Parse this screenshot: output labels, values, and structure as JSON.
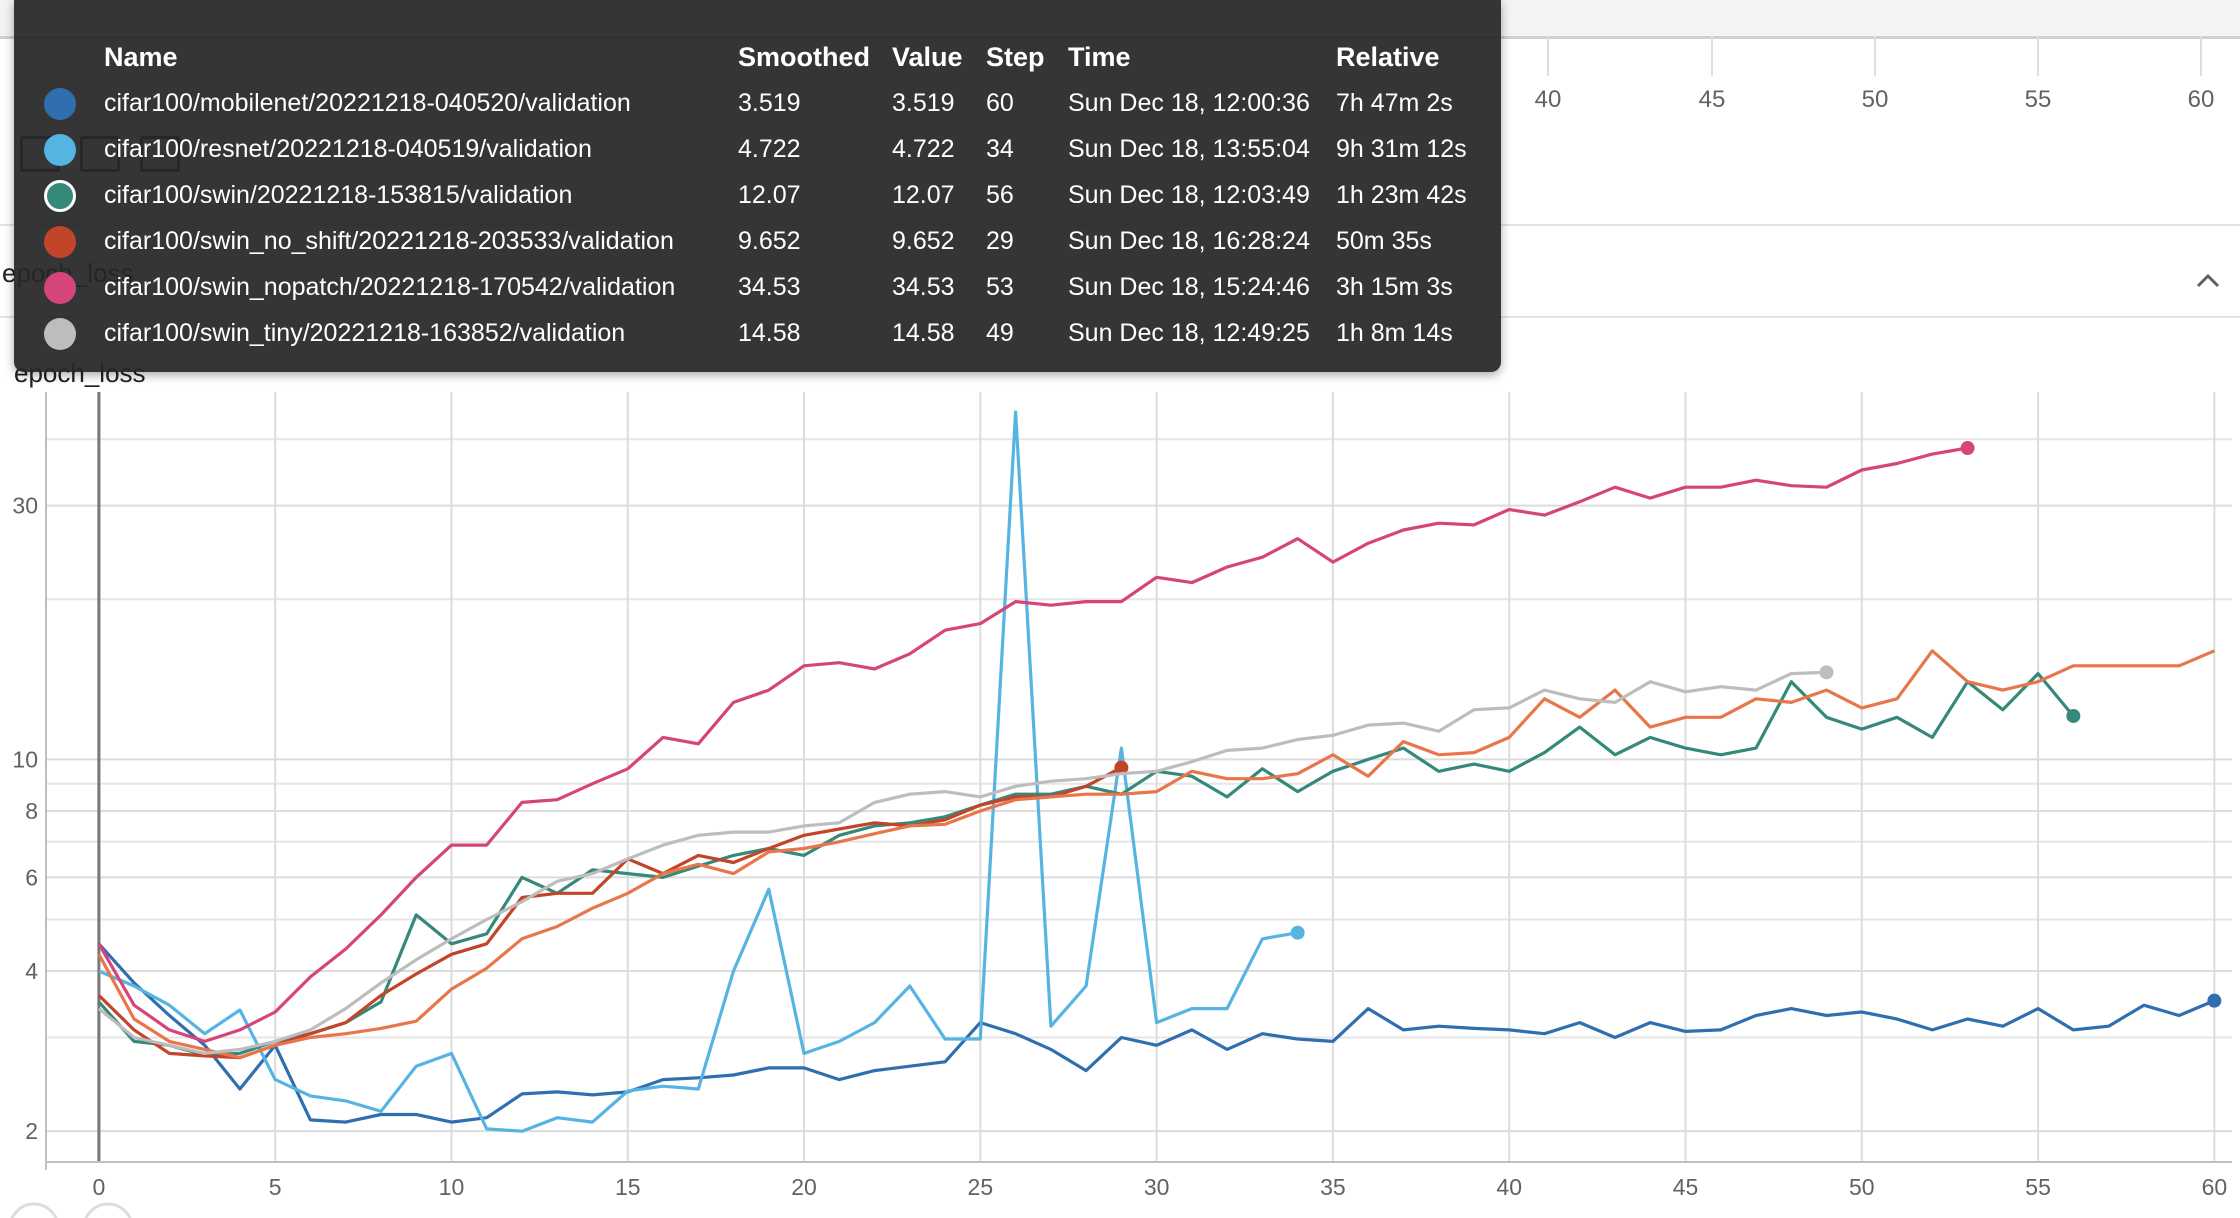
{
  "background": {
    "x_tick_labels": [
      "40",
      "45",
      "50",
      "55",
      "60"
    ],
    "card_title": "epoch_loss"
  },
  "tooltip": {
    "headers": {
      "name": "Name",
      "smoothed": "Smoothed",
      "value": "Value",
      "step": "Step",
      "time": "Time",
      "relative": "Relative"
    },
    "rows": [
      {
        "color": "#2f6fb0",
        "name": "cifar100/mobilenet/20221218-040520/validation",
        "smoothed": "3.519",
        "value": "3.519",
        "step": "60",
        "time": "Sun Dec 18, 12:00:36",
        "relative": "7h 47m 2s"
      },
      {
        "color": "#56b4e3",
        "name": "cifar100/resnet/20221218-040519/validation",
        "smoothed": "4.722",
        "value": "4.722",
        "step": "34",
        "time": "Sun Dec 18, 13:55:04",
        "relative": "9h 31m 12s"
      },
      {
        "color": "#34897a",
        "name": "cifar100/swin/20221218-153815/validation",
        "smoothed": "12.07",
        "value": "12.07",
        "step": "56",
        "time": "Sun Dec 18, 12:03:49",
        "relative": "1h 23m 42s"
      },
      {
        "color": "#c2452a",
        "name": "cifar100/swin_no_shift/20221218-203533/validation",
        "smoothed": "9.652",
        "value": "9.652",
        "step": "29",
        "time": "Sun Dec 18, 16:28:24",
        "relative": "50m 35s"
      },
      {
        "color": "#d6457a",
        "name": "cifar100/swin_nopatch/20221218-170542/validation",
        "smoothed": "34.53",
        "value": "34.53",
        "step": "53",
        "time": "Sun Dec 18, 15:24:46",
        "relative": "3h 15m 3s"
      },
      {
        "color": "#bdbdbd",
        "name": "cifar100/swin_tiny/20221218-163852/validation",
        "smoothed": "14.58",
        "value": "14.58",
        "step": "49",
        "time": "Sun Dec 18, 12:49:25",
        "relative": "1h 8m 14s"
      }
    ]
  },
  "chart_data": {
    "type": "line",
    "title": "epoch_loss",
    "xlabel": "",
    "ylabel": "",
    "xlim": [
      -1.5,
      60.5
    ],
    "ylim": [
      1.75,
      45
    ],
    "y_scale": "log",
    "x_ticks": [
      0,
      5,
      10,
      15,
      20,
      25,
      30,
      35,
      40,
      45,
      50,
      55,
      60
    ],
    "y_tick_labels": [
      2,
      4,
      6,
      8,
      10,
      30
    ],
    "y_minor_gridlines": [
      3,
      5,
      7,
      9,
      20,
      40
    ],
    "grid": true,
    "legend": "none",
    "series": [
      {
        "color": "#2f6fb0",
        "end_marker": true,
        "x": [
          0,
          1,
          2,
          3,
          4,
          5,
          6,
          7,
          8,
          9,
          10,
          11,
          12,
          13,
          14,
          15,
          16,
          17,
          18,
          19,
          20,
          21,
          22,
          23,
          24,
          25,
          26,
          27,
          28,
          29,
          30,
          31,
          32,
          33,
          34,
          35,
          36,
          37,
          38,
          39,
          40,
          41,
          42,
          43,
          44,
          45,
          46,
          47,
          48,
          49,
          50,
          51,
          52,
          53,
          54,
          55,
          56,
          57,
          58,
          59,
          60
        ],
        "y": [
          4.5,
          3.8,
          3.3,
          2.9,
          2.4,
          2.9,
          2.1,
          2.08,
          2.15,
          2.15,
          2.08,
          2.12,
          2.35,
          2.37,
          2.34,
          2.37,
          2.5,
          2.52,
          2.55,
          2.63,
          2.63,
          2.5,
          2.6,
          2.65,
          2.7,
          3.2,
          3.05,
          2.85,
          2.6,
          3.0,
          2.9,
          3.1,
          2.85,
          3.05,
          2.98,
          2.95,
          3.4,
          3.1,
          3.15,
          3.12,
          3.1,
          3.05,
          3.2,
          3.0,
          3.2,
          3.08,
          3.1,
          3.3,
          3.4,
          3.3,
          3.35,
          3.25,
          3.1,
          3.25,
          3.15,
          3.4,
          3.1,
          3.15,
          3.45,
          3.3,
          3.519
        ]
      },
      {
        "color": "#56b4e3",
        "end_marker": true,
        "x": [
          0,
          1,
          2,
          3,
          4,
          5,
          6,
          7,
          8,
          9,
          10,
          11,
          12,
          13,
          14,
          15,
          16,
          17,
          18,
          19,
          20,
          21,
          22,
          23,
          24,
          25,
          26,
          27,
          28,
          29,
          30,
          31,
          32,
          33,
          34
        ],
        "y": [
          4.0,
          3.75,
          3.45,
          3.05,
          3.38,
          2.5,
          2.33,
          2.28,
          2.18,
          2.65,
          2.8,
          2.02,
          2.0,
          2.12,
          2.08,
          2.38,
          2.43,
          2.4,
          4.0,
          5.7,
          2.8,
          2.95,
          3.2,
          3.75,
          2.98,
          2.98,
          45,
          3.15,
          3.75,
          10.5,
          3.2,
          3.4,
          3.4,
          4.6,
          4.722
        ]
      },
      {
        "color": "#34897a",
        "end_marker": true,
        "x": [
          0,
          1,
          2,
          3,
          4,
          5,
          6,
          7,
          8,
          9,
          10,
          11,
          12,
          13,
          14,
          15,
          16,
          17,
          18,
          19,
          20,
          21,
          22,
          23,
          24,
          25,
          26,
          27,
          28,
          29,
          30,
          31,
          32,
          33,
          34,
          35,
          36,
          37,
          38,
          39,
          40,
          41,
          42,
          43,
          44,
          45,
          46,
          47,
          48,
          49,
          50,
          51,
          52,
          53,
          54,
          55,
          56
        ],
        "y": [
          3.5,
          2.95,
          2.9,
          2.78,
          2.8,
          2.95,
          3.05,
          3.2,
          3.5,
          5.1,
          4.5,
          4.7,
          6.0,
          5.6,
          6.2,
          6.1,
          6.0,
          6.3,
          6.6,
          6.8,
          6.6,
          7.2,
          7.5,
          7.6,
          7.8,
          8.2,
          8.6,
          8.6,
          8.9,
          8.6,
          9.5,
          9.3,
          8.5,
          9.6,
          8.7,
          9.5,
          10.0,
          10.5,
          9.5,
          9.8,
          9.5,
          10.3,
          11.5,
          10.2,
          11.0,
          10.5,
          10.2,
          10.5,
          14.0,
          12.0,
          11.4,
          12.0,
          11.0,
          14.0,
          12.4,
          14.5,
          12.07
        ]
      },
      {
        "color": "#c2452a",
        "end_marker": true,
        "x": [
          0,
          1,
          2,
          3,
          4,
          5,
          6,
          7,
          8,
          9,
          10,
          11,
          12,
          13,
          14,
          15,
          16,
          17,
          18,
          19,
          20,
          21,
          22,
          23,
          24,
          25,
          26,
          27,
          28,
          29
        ],
        "y": [
          3.6,
          3.1,
          2.8,
          2.77,
          2.75,
          2.9,
          3.05,
          3.2,
          3.6,
          3.95,
          4.3,
          4.5,
          5.5,
          5.6,
          5.6,
          6.5,
          6.1,
          6.6,
          6.4,
          6.8,
          7.2,
          7.4,
          7.6,
          7.5,
          7.7,
          8.2,
          8.5,
          8.5,
          8.9,
          9.652
        ]
      },
      {
        "color": "#e8764a",
        "end_marker": false,
        "x": [
          0,
          1,
          2,
          3,
          4,
          5,
          6,
          7,
          8,
          9,
          10,
          11,
          12,
          13,
          14,
          15,
          16,
          17,
          18,
          19,
          20,
          21,
          22,
          23,
          24,
          25,
          26,
          27,
          28,
          29,
          30,
          31,
          32,
          33,
          34,
          35,
          36,
          37,
          38,
          39,
          40,
          41,
          42,
          43,
          44,
          45,
          46,
          47,
          48,
          49,
          50,
          51,
          52,
          53,
          54,
          55,
          56,
          57,
          58,
          59,
          60
        ],
        "y": [
          4.3,
          3.25,
          2.95,
          2.85,
          2.75,
          2.9,
          3.0,
          3.05,
          3.12,
          3.22,
          3.7,
          4.05,
          4.6,
          4.85,
          5.25,
          5.6,
          6.1,
          6.35,
          6.1,
          6.7,
          6.8,
          7.0,
          7.25,
          7.5,
          7.55,
          8.0,
          8.4,
          8.5,
          8.6,
          8.6,
          8.7,
          9.5,
          9.2,
          9.2,
          9.4,
          10.2,
          9.3,
          10.8,
          10.2,
          10.3,
          11.0,
          13.0,
          12.0,
          13.5,
          11.5,
          12.0,
          12.0,
          13.0,
          12.8,
          13.5,
          12.5,
          13.0,
          16.0,
          14.0,
          13.5,
          14.0,
          15.0,
          15.0,
          15.0,
          15.0,
          16.0
        ]
      },
      {
        "color": "#d6457a",
        "end_marker": true,
        "x": [
          0,
          1,
          2,
          3,
          4,
          5,
          6,
          7,
          8,
          9,
          10,
          11,
          12,
          13,
          14,
          15,
          16,
          17,
          18,
          19,
          20,
          21,
          22,
          23,
          24,
          25,
          26,
          27,
          28,
          29,
          30,
          31,
          32,
          33,
          34,
          35,
          36,
          37,
          38,
          39,
          40,
          41,
          42,
          43,
          44,
          45,
          46,
          47,
          48,
          49,
          50,
          51,
          52,
          53
        ],
        "y": [
          4.5,
          3.45,
          3.1,
          2.95,
          3.1,
          3.35,
          3.9,
          4.4,
          5.1,
          6.0,
          6.9,
          6.9,
          8.3,
          8.4,
          9.0,
          9.6,
          11.0,
          10.7,
          12.8,
          13.5,
          15.0,
          15.2,
          14.8,
          15.8,
          17.5,
          18.0,
          19.8,
          19.5,
          19.8,
          19.8,
          22.0,
          21.5,
          23.0,
          24.0,
          26.0,
          23.5,
          25.5,
          27.0,
          27.8,
          27.6,
          29.5,
          28.8,
          30.5,
          32.5,
          31.0,
          32.5,
          32.5,
          33.5,
          32.7,
          32.5,
          35.0,
          36.0,
          37.5,
          38.5
        ]
      },
      {
        "color": "#bdbdbd",
        "end_marker": true,
        "x": [
          0,
          1,
          2,
          3,
          4,
          5,
          6,
          7,
          8,
          9,
          10,
          11,
          12,
          13,
          14,
          15,
          16,
          17,
          18,
          19,
          20,
          21,
          22,
          23,
          24,
          25,
          26,
          27,
          28,
          29,
          30,
          31,
          32,
          33,
          34,
          35,
          36,
          37,
          38,
          39,
          40,
          41,
          42,
          43,
          44,
          45,
          46,
          47,
          48,
          49
        ],
        "y": [
          3.4,
          3.0,
          2.9,
          2.8,
          2.85,
          2.95,
          3.1,
          3.4,
          3.8,
          4.2,
          4.6,
          5.0,
          5.4,
          5.9,
          6.1,
          6.5,
          6.9,
          7.2,
          7.3,
          7.3,
          7.5,
          7.6,
          8.3,
          8.6,
          8.7,
          8.5,
          8.9,
          9.1,
          9.2,
          9.4,
          9.5,
          9.9,
          10.4,
          10.5,
          10.9,
          11.1,
          11.6,
          11.7,
          11.3,
          12.4,
          12.5,
          13.5,
          13.0,
          12.8,
          14.0,
          13.4,
          13.7,
          13.5,
          14.5,
          14.58
        ]
      }
    ]
  }
}
